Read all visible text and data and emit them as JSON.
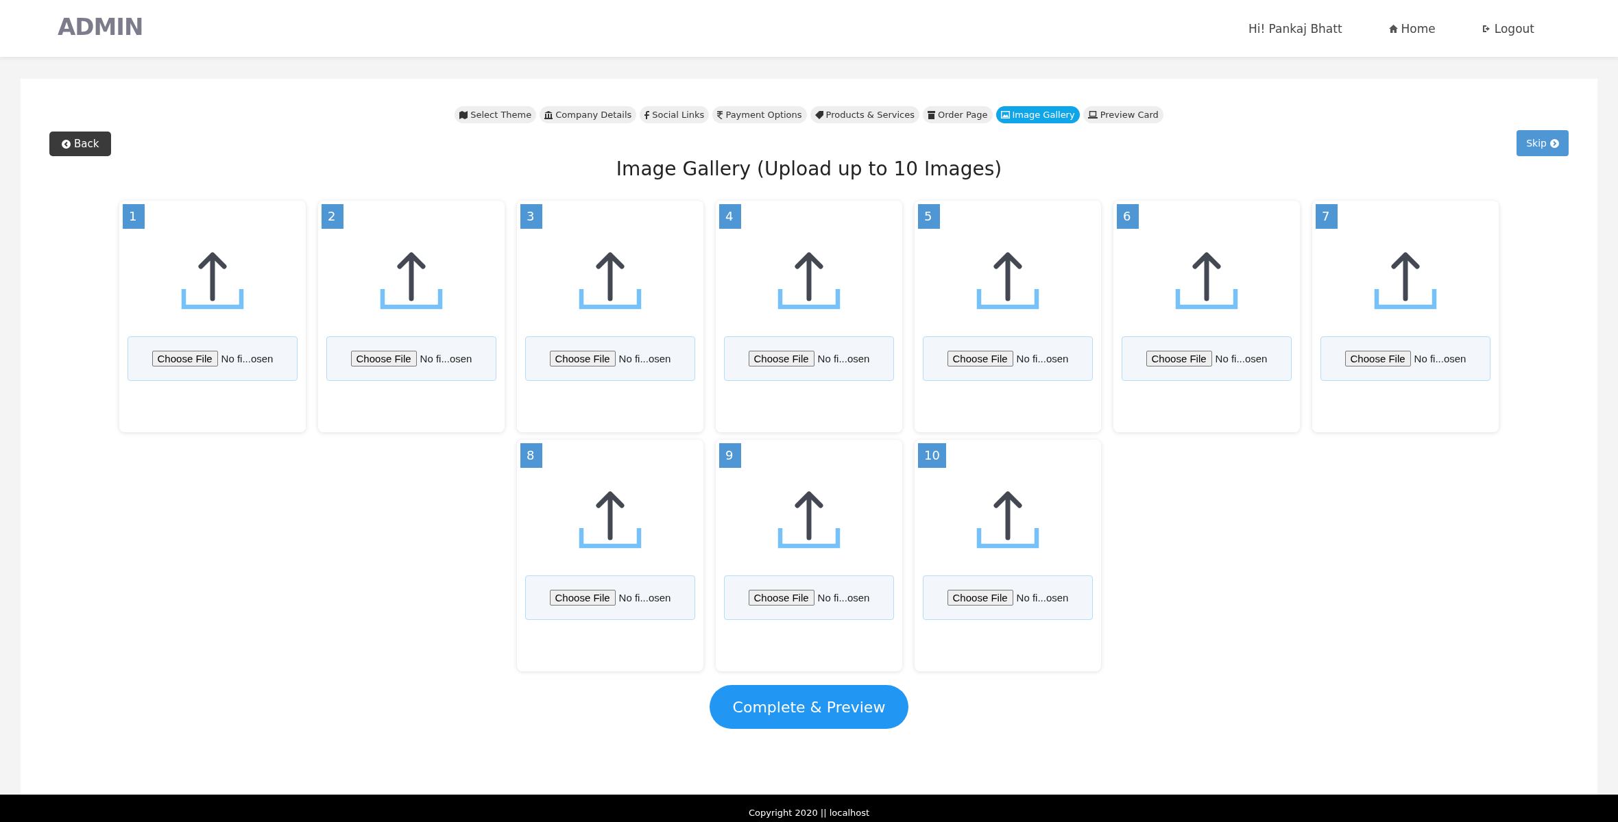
{
  "header": {
    "logo": "ADMIN",
    "greeting": "Hi! Pankaj Bhatt",
    "nav": [
      "Home",
      "Logout"
    ]
  },
  "steps": [
    {
      "label": "Select Theme",
      "selected": false
    },
    {
      "label": "Company Details",
      "selected": false
    },
    {
      "label": "Social Links",
      "selected": false
    },
    {
      "label": "Payment Options",
      "selected": false
    },
    {
      "label": "Products & Services",
      "selected": false
    },
    {
      "label": "Order Page",
      "selected": false
    },
    {
      "label": "Image Gallery",
      "selected": true
    },
    {
      "label": "Preview Card",
      "selected": false
    }
  ],
  "back_button": "Back",
  "skip_button": "Skip",
  "title": "Image Gallery (Upload up to 10 Images)",
  "uploads": [
    {
      "number": "1",
      "button": "Choose File",
      "status": "No fi...osen"
    },
    {
      "number": "2",
      "button": "Choose File",
      "status": "No fi...osen"
    },
    {
      "number": "3",
      "button": "Choose File",
      "status": "No fi...osen"
    },
    {
      "number": "4",
      "button": "Choose File",
      "status": "No fi...osen"
    },
    {
      "number": "5",
      "button": "Choose File",
      "status": "No fi...osen"
    },
    {
      "number": "6",
      "button": "Choose File",
      "status": "No fi...osen"
    },
    {
      "number": "7",
      "button": "Choose File",
      "status": "No fi...osen"
    },
    {
      "number": "8",
      "button": "Choose File",
      "status": "No fi...osen"
    },
    {
      "number": "9",
      "button": "Choose File",
      "status": "No fi...osen"
    },
    {
      "number": "10",
      "button": "Choose File",
      "status": "No fi...osen"
    }
  ],
  "submit_button": "Complete & Preview",
  "footer": "Copyright 2020 || localhost"
}
